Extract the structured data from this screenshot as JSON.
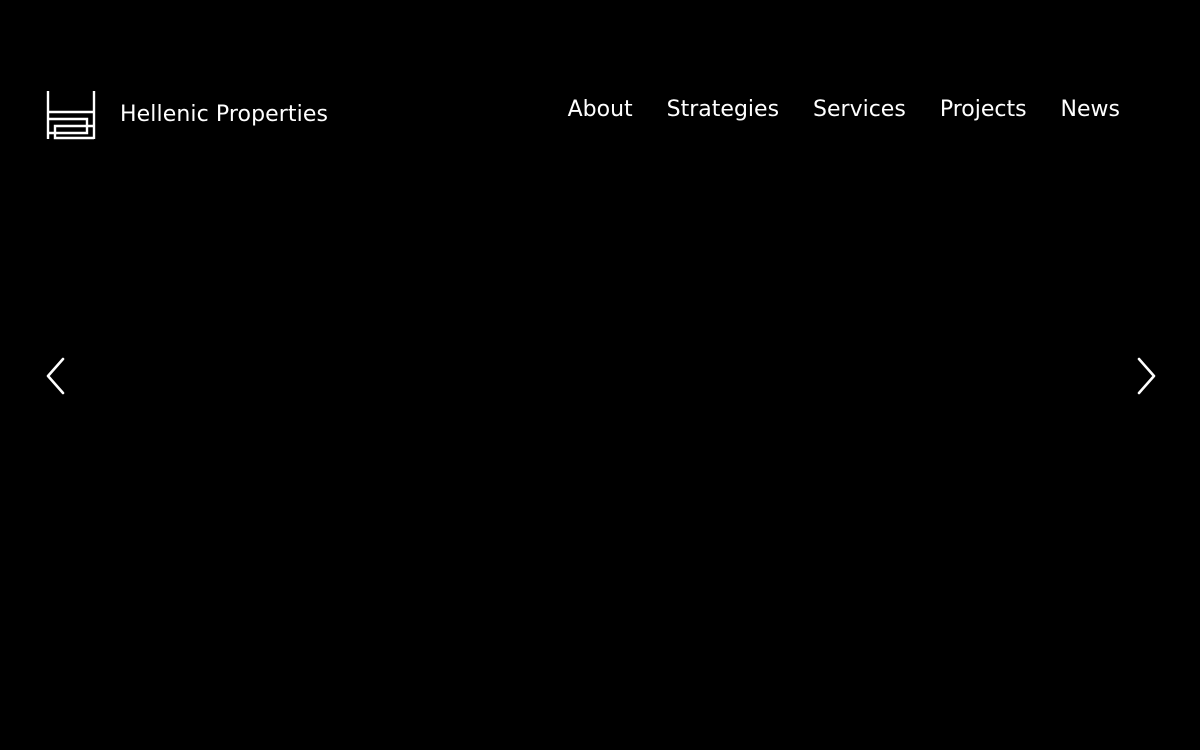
{
  "header": {
    "brand_name": "Hellenic Properties",
    "logo_icon": "hellenic-properties-logo"
  },
  "nav": {
    "items": [
      {
        "label": "About"
      },
      {
        "label": "Strategies"
      },
      {
        "label": "Services"
      },
      {
        "label": "Projects"
      },
      {
        "label": "News"
      }
    ]
  },
  "slider": {
    "prev_icon": "chevron-left-icon",
    "next_icon": "chevron-right-icon"
  },
  "colors": {
    "background": "#000000",
    "foreground": "#ffffff"
  }
}
